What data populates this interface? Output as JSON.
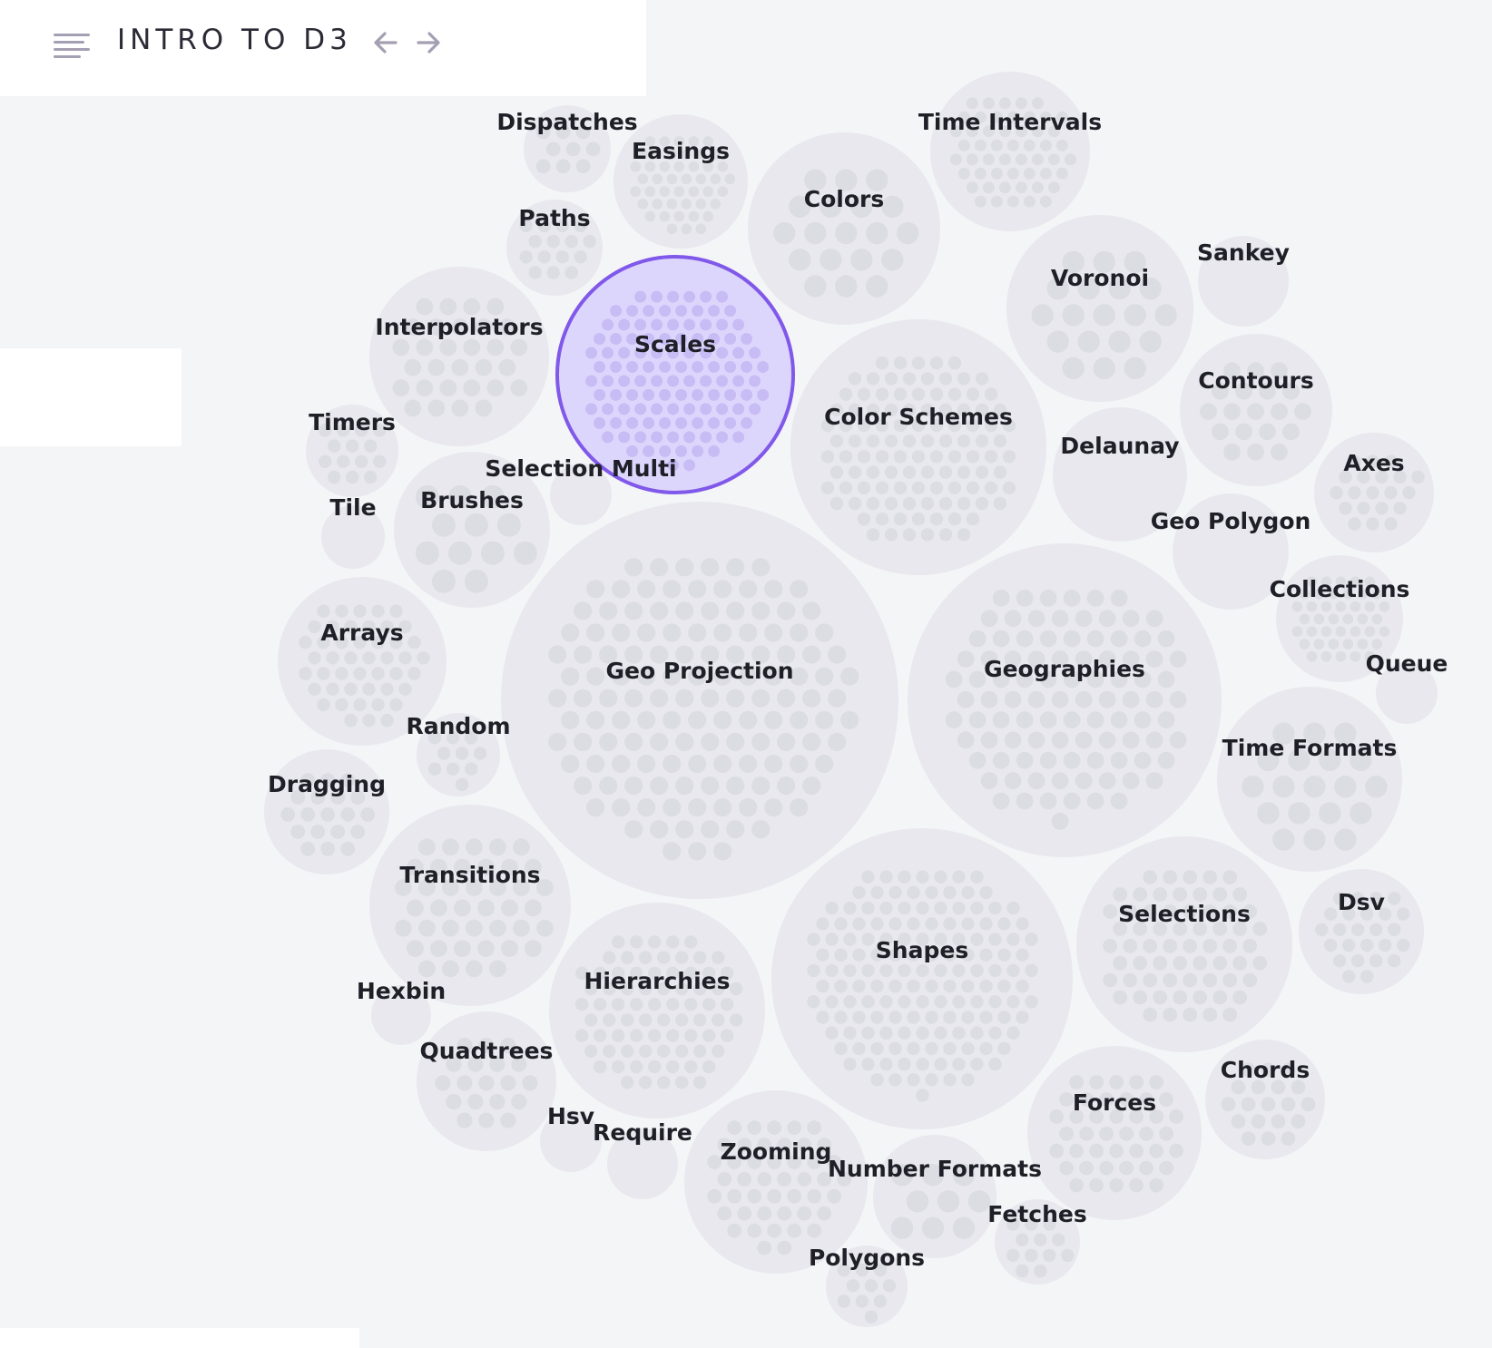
{
  "header": {
    "title": "INTRO TO D3",
    "menu_icon": "hamburger-menu-icon",
    "back_icon": "arrow-left-icon",
    "forward_icon": "arrow-right-icon"
  },
  "colors": {
    "background": "#f4f5f7",
    "bubble": "#e8e8ee",
    "dot": "#dcdce3",
    "selected_fill": "#ddd6fc",
    "selected_stroke": "#8058ea",
    "icon": "#a49fb2"
  },
  "selected_topic": "Scales",
  "topics": [
    "Dispatches",
    "Easings",
    "Time Intervals",
    "Colors",
    "Paths",
    "Sankey",
    "Voronoi",
    "Interpolators",
    "Scales",
    "Contours",
    "Color Schemes",
    "Timers",
    "Delaunay",
    "Axes",
    "Selection Multi",
    "Brushes",
    "Tile",
    "Geo Polygon",
    "Collections",
    "Arrays",
    "Geo Projection",
    "Geographies",
    "Queue",
    "Random",
    "Time Formats",
    "Dragging",
    "Transitions",
    "Dsv",
    "Selections",
    "Shapes",
    "Hierarchies",
    "Hexbin",
    "Quadtrees",
    "Chords",
    "Forces",
    "Hsv",
    "Require",
    "Zooming",
    "Number Formats",
    "Fetches",
    "Polygons"
  ]
}
